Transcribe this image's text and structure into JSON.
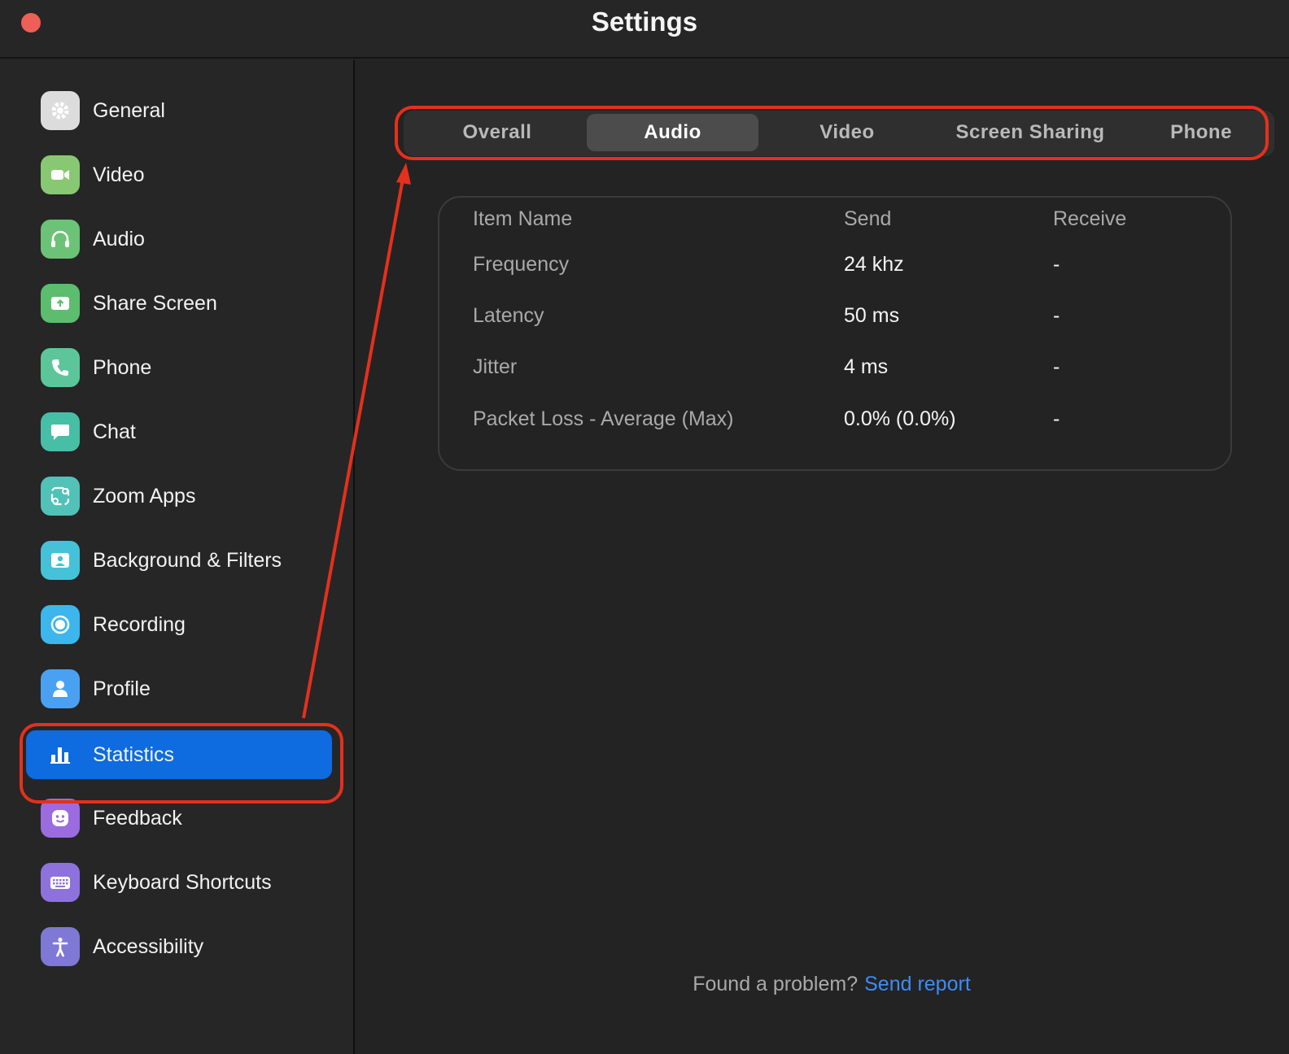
{
  "window": {
    "title": "Settings"
  },
  "sidebar": {
    "items": [
      {
        "label": "General",
        "icon": "gear-icon",
        "color": "#dcdcdc"
      },
      {
        "label": "Video",
        "icon": "video-camera-icon",
        "color": "#88c872"
      },
      {
        "label": "Audio",
        "icon": "headphones-icon",
        "color": "#6cc276"
      },
      {
        "label": "Share Screen",
        "icon": "share-screen-icon",
        "color": "#5cbd6e"
      },
      {
        "label": "Phone",
        "icon": "phone-icon",
        "color": "#5cc69a"
      },
      {
        "label": "Chat",
        "icon": "chat-bubble-icon",
        "color": "#47bfa7"
      },
      {
        "label": "Zoom Apps",
        "icon": "apps-icon",
        "color": "#52c2b8"
      },
      {
        "label": "Background & Filters",
        "icon": "background-portrait-icon",
        "color": "#45c2d8"
      },
      {
        "label": "Recording",
        "icon": "record-icon",
        "color": "#3cb6ec"
      },
      {
        "label": "Profile",
        "icon": "person-icon",
        "color": "#4aa1f2"
      },
      {
        "label": "Statistics",
        "icon": "bar-chart-icon",
        "color": "#0e6be0",
        "active": true
      },
      {
        "label": "Feedback",
        "icon": "smiley-icon",
        "color": "#9b6be0"
      },
      {
        "label": "Keyboard Shortcuts",
        "icon": "keyboard-icon",
        "color": "#8e72dc"
      },
      {
        "label": "Accessibility",
        "icon": "accessibility-icon",
        "color": "#7f78d4"
      }
    ]
  },
  "tabs": [
    {
      "label": "Overall"
    },
    {
      "label": "Audio",
      "active": true
    },
    {
      "label": "Video"
    },
    {
      "label": "Screen Sharing"
    },
    {
      "label": "Phone"
    }
  ],
  "stats_table": {
    "headers": [
      "Item Name",
      "Send",
      "Receive"
    ],
    "rows": [
      {
        "name": "Frequency",
        "send": "24 khz",
        "receive": "-"
      },
      {
        "name": "Latency",
        "send": "50 ms",
        "receive": "-"
      },
      {
        "name": "Jitter",
        "send": "4 ms",
        "receive": "-"
      },
      {
        "name": "Packet Loss - Average (Max)",
        "send": "0.0% (0.0%)",
        "receive": "-"
      }
    ]
  },
  "footer": {
    "prompt": "Found a problem?",
    "link": "Send report"
  },
  "colors": {
    "accent": "#0e6be0",
    "annotation": "#e5301c",
    "link": "#3d8cf5"
  }
}
